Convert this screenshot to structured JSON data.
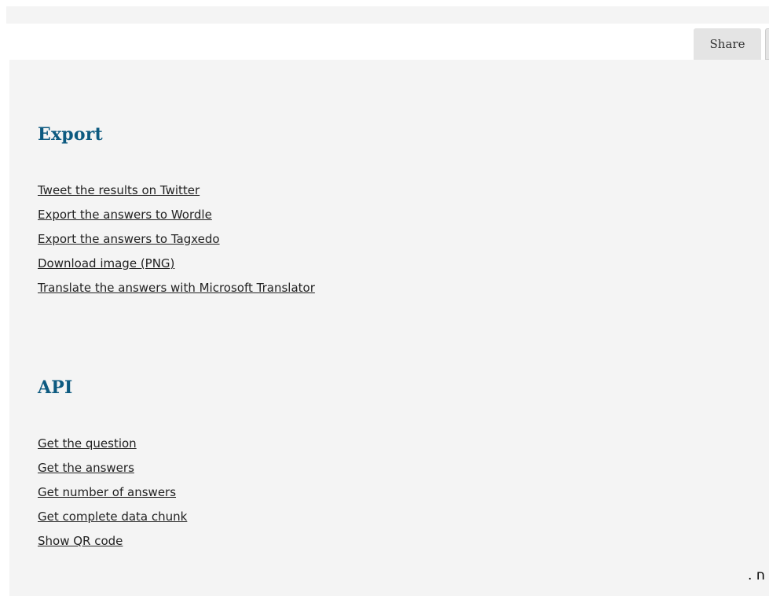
{
  "toolbar": {
    "share_label": "Share"
  },
  "export": {
    "title": "Export",
    "links": [
      "Tweet the results on Twitter",
      "Export the answers to Wordle",
      "Export the answers to Tagxedo",
      "Download image (PNG)",
      "Translate the answers with Microsoft Translator"
    ]
  },
  "api": {
    "title": "API",
    "links": [
      "Get the question",
      "Get the answers",
      "Get number of answers",
      "Get complete data chunk",
      "Show QR code"
    ]
  },
  "footer": {
    "corner_text": ". ח"
  },
  "colors": {
    "heading": "#0d5a80",
    "panel_bg": "#f4f4f4",
    "button_bg": "#e4e4e4"
  }
}
